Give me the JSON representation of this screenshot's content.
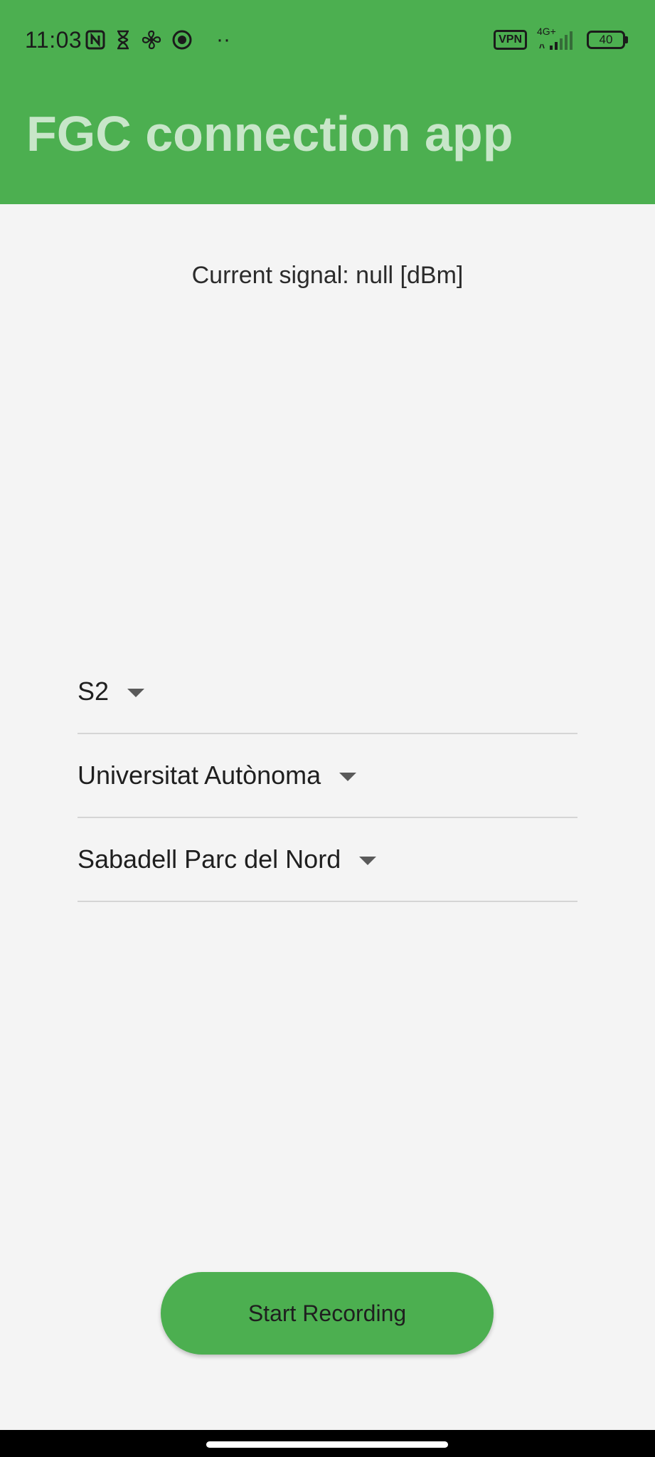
{
  "status_bar": {
    "time": "11:03",
    "left_icons": [
      "nfc-icon",
      "hourglass-icon",
      "fan-icon",
      "circle-app-icon"
    ],
    "overflow": "··",
    "vpn_label": "VPN",
    "network_label": "4G+",
    "battery_level": "40"
  },
  "app_bar": {
    "title": "FGC connection app",
    "color": "#4caf50",
    "title_color": "#c8e6c9"
  },
  "signal": {
    "text": "Current signal:  null [dBm]"
  },
  "dropdowns": {
    "line": {
      "value": "S2"
    },
    "from_station": {
      "value": "Universitat Autònoma"
    },
    "to_station": {
      "value": "Sabadell Parc del Nord"
    }
  },
  "actions": {
    "record_label": "Start Recording"
  }
}
